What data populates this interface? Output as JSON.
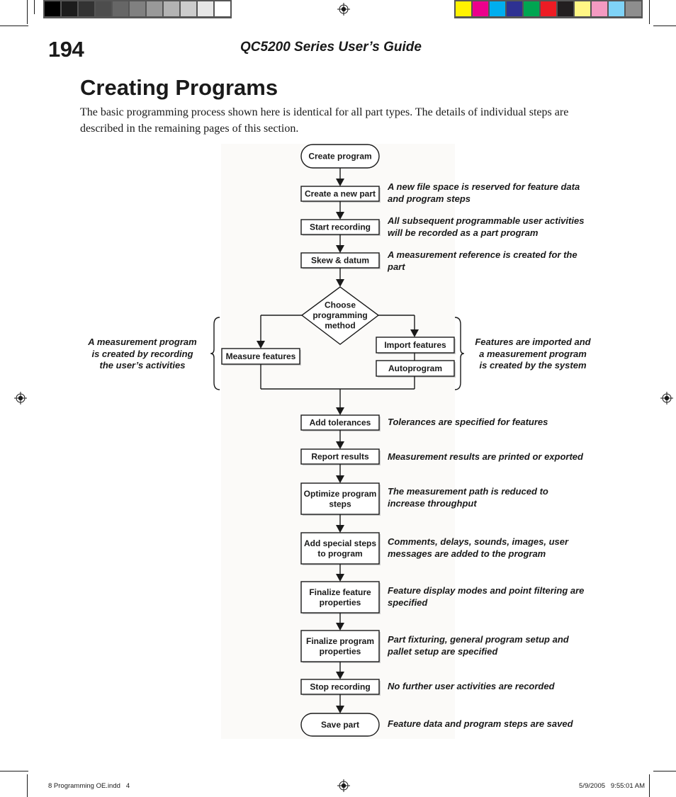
{
  "printer_marks": {
    "gray_swatches": [
      "#000000",
      "#1c1c1c",
      "#333333",
      "#4d4d4d",
      "#666666",
      "#808080",
      "#999999",
      "#b3b3b3",
      "#cccccc",
      "#e6e6e6",
      "#ffffff"
    ],
    "color_swatches": [
      "#fff200",
      "#ec008c",
      "#00aeef",
      "#2e3192",
      "#00a651",
      "#ed1c24",
      "#231f20",
      "#fff685",
      "#f49ac1",
      "#7fd3f7",
      "#8e8e8e"
    ]
  },
  "header": {
    "page_number": "194",
    "running_head": "QC5200 Series User’s Guide"
  },
  "section": {
    "title": "Creating Programs",
    "intro": "The basic programming process shown here is identical for all part types.  The details of individual steps are described in the remaining pages of this section."
  },
  "flowchart": {
    "start": "Create program",
    "steps": [
      {
        "label": [
          "Create a new part"
        ],
        "note": [
          "A new file space is reserved for feature data",
          "and program steps"
        ]
      },
      {
        "label": [
          "Start recording"
        ],
        "note": [
          "All subsequent programmable user activities",
          "will be recorded as a part program"
        ]
      },
      {
        "label": [
          "Skew & datum"
        ],
        "note": [
          "A measurement reference is created for the",
          "part"
        ]
      }
    ],
    "decision": [
      "Choose",
      "programming",
      "method"
    ],
    "branch_left": {
      "label": "Measure features",
      "note": [
        "A measurement program",
        "is created by recording",
        "the user’s activities"
      ]
    },
    "branch_right": {
      "labels": [
        "Import features",
        "Autoprogram"
      ],
      "note": [
        "Features are imported and",
        "a measurement program",
        "is created by the system"
      ]
    },
    "steps_after": [
      {
        "label": [
          "Add tolerances"
        ],
        "note": [
          "Tolerances are specified for features"
        ]
      },
      {
        "label": [
          "Report results"
        ],
        "note": [
          "Measurement results are printed or exported"
        ]
      },
      {
        "label": [
          "Optimize program",
          "steps"
        ],
        "note": [
          "The measurement path is reduced  to",
          "increase throughput"
        ]
      },
      {
        "label": [
          "Add special steps",
          "to program"
        ],
        "note": [
          "Comments, delays, sounds, images, user",
          "messages are added to the program"
        ]
      },
      {
        "label": [
          "Finalize feature",
          "properties"
        ],
        "note": [
          "Feature display modes and point filtering are",
          "specified"
        ]
      },
      {
        "label": [
          "Finalize program",
          "properties"
        ],
        "note": [
          "Part fixturing, general program setup and",
          "pallet setup are specified"
        ]
      },
      {
        "label": [
          "Stop recording"
        ],
        "note": [
          "No further user activities are recorded"
        ]
      }
    ],
    "end": {
      "label": "Save part",
      "note": "Feature data and program steps are saved"
    }
  },
  "footer": {
    "file_slug": "8 Programming OE.indd   4",
    "timestamp": "5/9/2005   9:55:01 AM"
  }
}
